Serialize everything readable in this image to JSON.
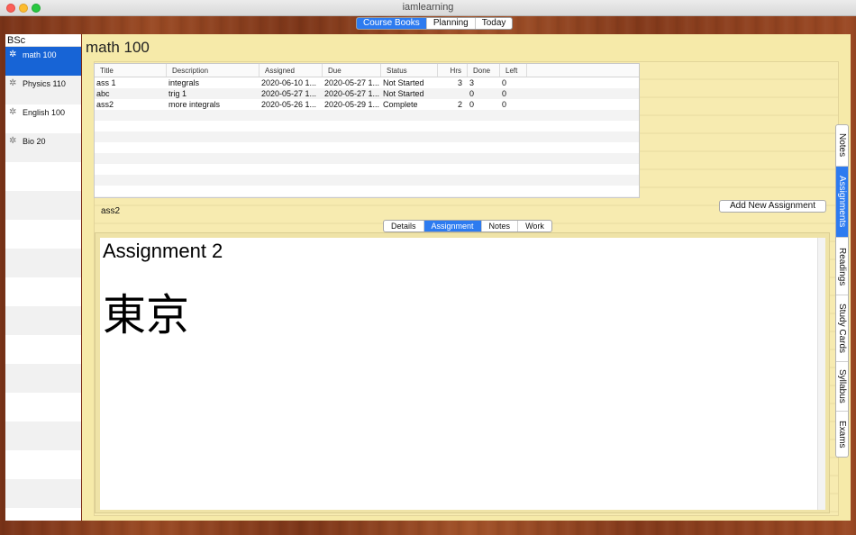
{
  "window": {
    "title": "iamlearning"
  },
  "top_tabs": [
    {
      "label": "Course Books",
      "active": true
    },
    {
      "label": "Planning",
      "active": false
    },
    {
      "label": "Today",
      "active": false
    }
  ],
  "sidebar": {
    "header": "BSc",
    "items": [
      {
        "label": "math 100",
        "active": true,
        "icon": "gear-icon"
      },
      {
        "label": "Physics 110",
        "active": false,
        "icon": "gear-icon"
      },
      {
        "label": "English 100",
        "active": false,
        "icon": "gear-icon"
      },
      {
        "label": "Bio 20",
        "active": false,
        "icon": "gear-icon"
      }
    ]
  },
  "main": {
    "title": "math 100",
    "table": {
      "columns": [
        "Title",
        "Description",
        "Assigned",
        "Due",
        "Status",
        "Hrs",
        "Done",
        "Left"
      ],
      "rows": [
        {
          "title": "ass 1",
          "desc": "integrals",
          "assigned": "2020-06-10 1...",
          "due": "2020-05-27 1...",
          "status": "Not Started",
          "hrs": "3",
          "done": "3",
          "left": "0"
        },
        {
          "title": "abc",
          "desc": "trig 1",
          "assigned": "2020-05-27 1...",
          "due": "2020-05-27 1...",
          "status": "Not Started",
          "hrs": "",
          "done": "0",
          "left": "0"
        },
        {
          "title": "ass2",
          "desc": "more integrals",
          "assigned": "2020-05-26 1...",
          "due": "2020-05-29 1...",
          "status": "Complete",
          "hrs": "2",
          "done": "0",
          "left": "0"
        }
      ]
    },
    "selected_label": "ass2",
    "add_button": "Add New Assignment",
    "detail_tabs": [
      {
        "label": "Details",
        "active": false
      },
      {
        "label": "Assignment",
        "active": true
      },
      {
        "label": "Notes",
        "active": false
      },
      {
        "label": "Work",
        "active": false
      }
    ],
    "editor": {
      "heading": "Assignment 2",
      "body": "東京"
    }
  },
  "side_tabs": [
    {
      "label": "Notes",
      "active": false
    },
    {
      "label": "Assignments",
      "active": true
    },
    {
      "label": "Readings",
      "active": false
    },
    {
      "label": "Study Cards",
      "active": false
    },
    {
      "label": "Syllabus",
      "active": false
    },
    {
      "label": "Exams",
      "active": false
    }
  ],
  "colors": {
    "accent": "#2d7bf0",
    "sidebar_selected": "#1764d6",
    "paper": "#f6eaa9"
  }
}
